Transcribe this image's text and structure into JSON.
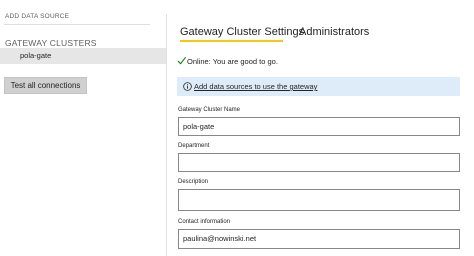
{
  "sidebar": {
    "add_data_source": "ADD DATA SOURCE",
    "gateway_clusters_heading": "GATEWAY CLUSTERS",
    "clusters": [
      {
        "label": "pola-gate"
      }
    ],
    "test_button_label": "Test all connections"
  },
  "tabs": [
    {
      "label": "Gateway Cluster Settings",
      "active": true
    },
    {
      "label": "Administrators",
      "active": false
    }
  ],
  "accent_color": "#f2c811",
  "status": {
    "text": "Online: You are good to go.",
    "icon": "check-icon",
    "color": "#107c10"
  },
  "info_bar": {
    "icon": "info-icon",
    "link_text": "Add data sources to use the gateway",
    "background": "#deecf9"
  },
  "form": {
    "gateway_cluster_name": {
      "label": "Gateway Cluster Name",
      "value": "pola-gate"
    },
    "department": {
      "label": "Department",
      "value": ""
    },
    "description": {
      "label": "Description",
      "value": ""
    },
    "contact_information": {
      "label": "Contact information",
      "value": "paulina@nowinski.net"
    }
  }
}
